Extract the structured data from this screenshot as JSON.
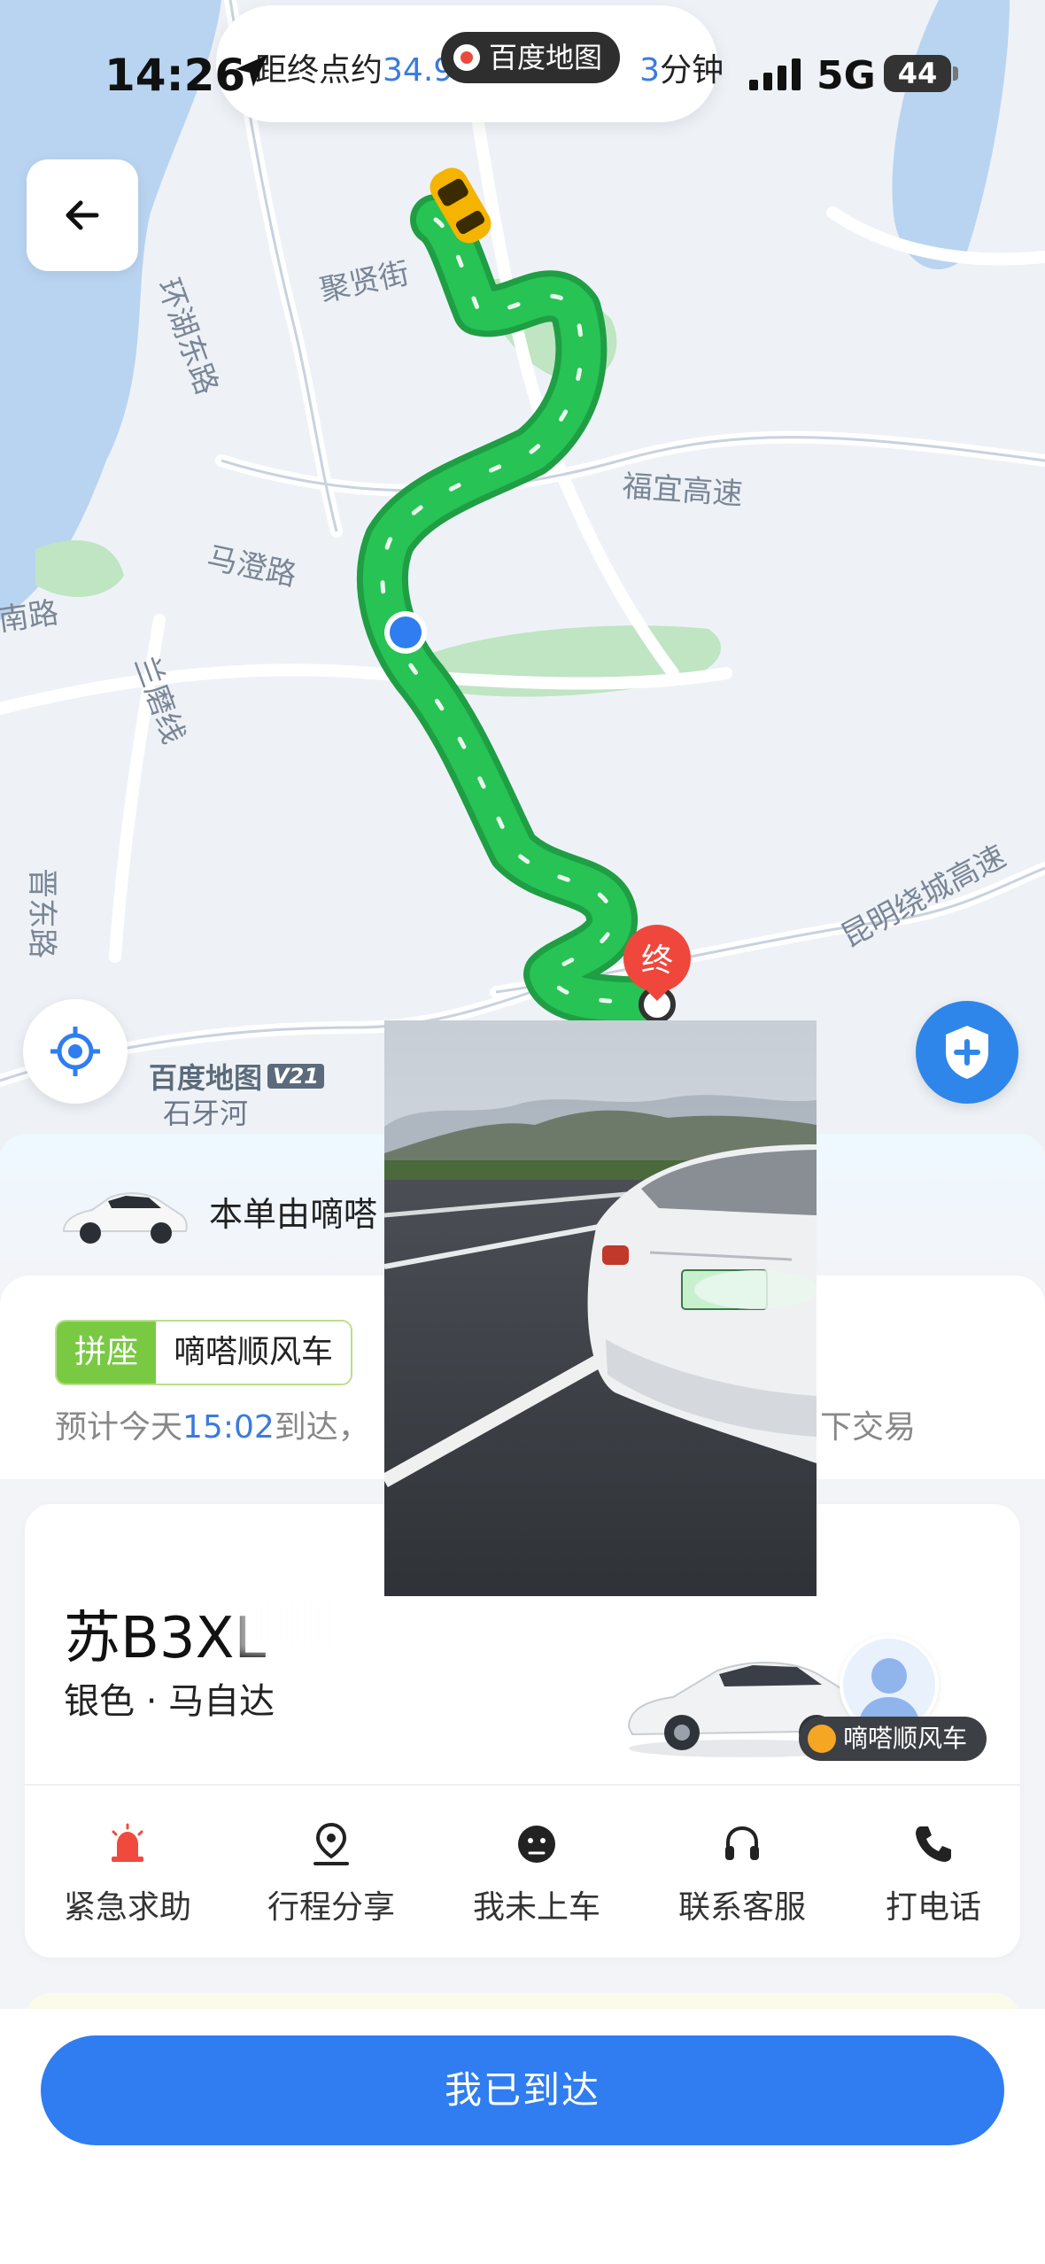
{
  "status_bar": {
    "time": "14:26",
    "network": "5G",
    "battery": "44"
  },
  "eta_banner": {
    "prefix": "距终点约",
    "distance_value": "34.9",
    "minutes_tail": "3",
    "suffix": "分钟",
    "app_brand": "百度地图"
  },
  "map": {
    "streets": [
      "聚贤街",
      "环湖东路",
      "福宜高速",
      "马澄路",
      "南路",
      "兰磨线",
      "晋东路",
      "昆明绕城高速"
    ],
    "destination_marker": "终",
    "watermark_brand": "百度地图",
    "watermark_version": "V21",
    "place_label": "石牙河"
  },
  "driver_banner": {
    "text": "本单由嘀嗒"
  },
  "trip": {
    "tag_carpool": "拼座",
    "tag_service": "嘀嗒顺风车",
    "eta_prefix": "预计今天",
    "eta_time": "15:02",
    "eta_suffix": "到达，",
    "trade_hint": "下交易"
  },
  "vehicle": {
    "plate": "苏B3XL",
    "description": "银色 · 马自达",
    "service_label": "嘀嗒顺风车"
  },
  "actions": [
    {
      "label": "紧急求助",
      "icon": "alarm-light-icon"
    },
    {
      "label": "行程分享",
      "icon": "location-share-icon"
    },
    {
      "label": "我未上车",
      "icon": "sad-face-icon"
    },
    {
      "label": "联系客服",
      "icon": "headset-icon"
    },
    {
      "label": "打电话",
      "icon": "phone-icon"
    }
  ],
  "primary_button": {
    "label": "我已到达"
  },
  "colors": {
    "route_green": "#21b64d",
    "accent_blue": "#2f7df0",
    "carpool_green": "#7ac943",
    "sos_red": "#f04a3e"
  }
}
